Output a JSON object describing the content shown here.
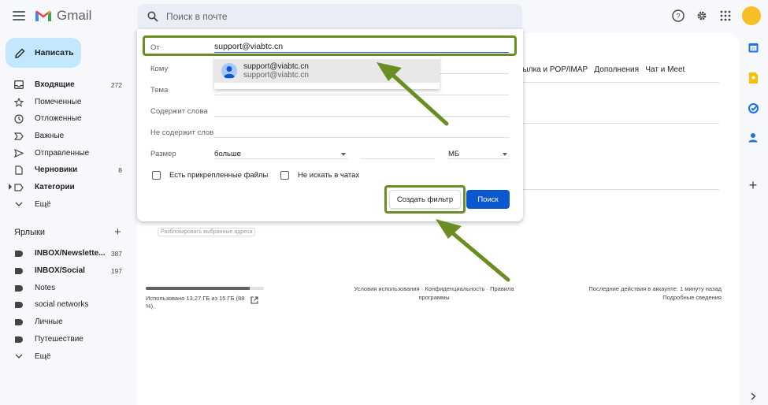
{
  "app": {
    "name": "Gmail"
  },
  "search": {
    "placeholder": "Поиск в почте"
  },
  "compose": {
    "label": "Написать"
  },
  "nav": [
    {
      "label": "Входящие",
      "count": "272",
      "icon": "inbox-icon",
      "bold": true
    },
    {
      "label": "Помеченные",
      "count": "",
      "icon": "star-icon",
      "bold": false
    },
    {
      "label": "Отложенные",
      "count": "",
      "icon": "clock-icon",
      "bold": false
    },
    {
      "label": "Важные",
      "count": "",
      "icon": "important-icon",
      "bold": false
    },
    {
      "label": "Отправленные",
      "count": "",
      "icon": "send-icon",
      "bold": false
    },
    {
      "label": "Черновики",
      "count": "8",
      "icon": "draft-icon",
      "bold": true
    },
    {
      "label": "Категории",
      "count": "",
      "icon": "label-icon",
      "bold": true
    },
    {
      "label": "Ещё",
      "count": "",
      "icon": "chevron-down-icon",
      "bold": false
    }
  ],
  "labels": {
    "title": "Ярлыки",
    "items": [
      {
        "label": "INBOX/Newslette...",
        "count": "387",
        "bold": true
      },
      {
        "label": "INBOX/Social",
        "count": "197",
        "bold": true
      },
      {
        "label": "Notes",
        "count": "",
        "bold": false
      },
      {
        "label": "social networks",
        "count": "",
        "bold": false
      },
      {
        "label": "Личные",
        "count": "",
        "bold": false
      },
      {
        "label": "Путешествие",
        "count": "",
        "bold": false
      }
    ],
    "more": "Ещё"
  },
  "settings_tabs": {
    "text": "есылка и POP/IMAP   Дополнения   Чат и Meet"
  },
  "unblock": {
    "label": "Разблокировать выбранные адреса"
  },
  "storage": {
    "text": "Использовано 13,27 ГБ из 15 ГБ (88 %).",
    "fraction": 0.88
  },
  "footer": {
    "center": "Условия использования · Конфиденциальность · Правила программы",
    "right_line1": "Последние действия в аккаунте: 1 минуту назад",
    "right_line2": "Подробные сведения"
  },
  "filter": {
    "from_label": "От",
    "from_value": "support@viabtc.cn",
    "to_label": "Кому",
    "subject_label": "Тема",
    "has_words_label": "Содержит слова",
    "no_words_label": "Не содержит слов",
    "size_label": "Размер",
    "size_op": "больше",
    "size_unit": "МБ",
    "attachments_label": "Есть прикрепленные файлы",
    "no_chats_label": "Не искать в чатах",
    "create_filter": "Создать фильтр",
    "search_button": "Поиск"
  },
  "suggestion": {
    "line1": "support@viabtc.cn",
    "line2": "support@viabtc.cn"
  },
  "colors": {
    "highlight": "#6b8e23",
    "primary": "#0b57d0",
    "compose_bg": "#c2e7ff"
  }
}
